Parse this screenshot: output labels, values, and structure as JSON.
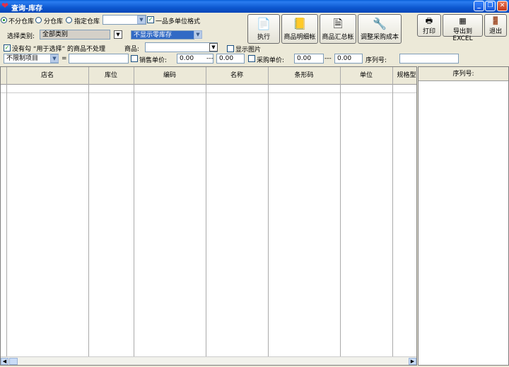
{
  "window": {
    "title": "查询-库存",
    "minimize": "_",
    "maximize": "❐",
    "close": "✕"
  },
  "warehouse": {
    "option1": "不分仓库",
    "option2": "分仓库",
    "option3": "指定仓库",
    "selected": "option1",
    "multi_unit_label": "一品多单位格式",
    "multi_unit_checked": true
  },
  "filters": {
    "category_label": "选择类别:",
    "category_value": "全部类别",
    "zero_stock_value": "不显示零库存",
    "unchecked_goods_label": "没有勾 “用于选择” 的商品不处理",
    "goods_label": "商品:",
    "goods_value": "",
    "show_image_label": "显示图片",
    "item_value": "不限制项目",
    "equals": "=",
    "sale_price_label": "销售单价:",
    "sale_from": "0.00",
    "sale_to": "0.00",
    "purchase_price_label": "采购单价:",
    "purchase_from": "0.00",
    "purchase_to": "0.00",
    "range_sep": "---",
    "serial_label": "序列号:",
    "serial_value": ""
  },
  "toolbar": {
    "execute": "执行",
    "item_detail": "商品明细帐",
    "item_summary": "商品汇总帐",
    "adjust_cost": "调整采购成本",
    "print": "打印",
    "export_excel": "导出到EXCEL",
    "exit": "退出"
  },
  "table": {
    "columns": [
      "店名",
      "库位",
      "编码",
      "名称",
      "条形码",
      "单位",
      "规格型"
    ]
  },
  "side_panel": {
    "header": "序列号:"
  }
}
